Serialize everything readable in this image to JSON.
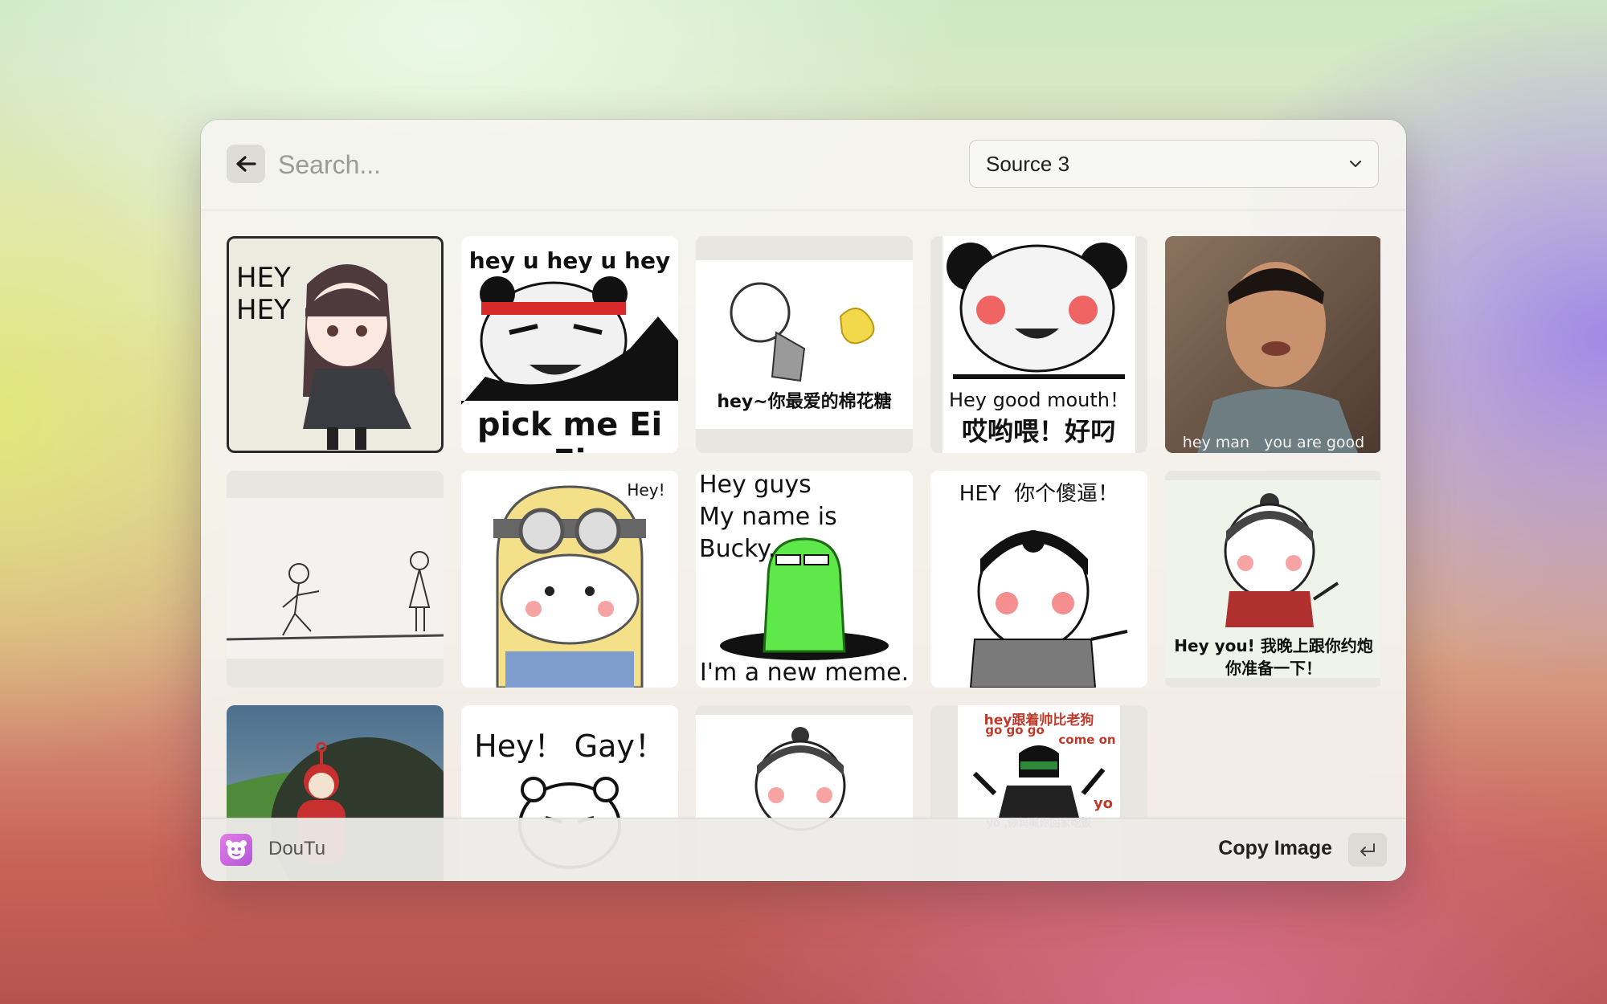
{
  "search": {
    "placeholder": "Search..."
  },
  "source_select": {
    "selected": "Source 3"
  },
  "grid": {
    "items": [
      {
        "caption": "HEY HEY"
      },
      {
        "caption_top": "hey u hey u hey",
        "caption_bottom": "pick me Ei Ei"
      },
      {
        "caption": "hey~你最爱的棉花糖"
      },
      {
        "caption": "Hey good mouth！",
        "caption_2": "哎哟喂！好叼"
      },
      {
        "caption": "hey man   you are good"
      },
      {
        "caption": ""
      },
      {
        "caption": "Hey!"
      },
      {
        "caption_lines": [
          "Hey guys",
          "My name is",
          "Bucky."
        ],
        "caption_bottom": "I'm a new meme."
      },
      {
        "caption": "HEY  你个傻逼！"
      },
      {
        "caption": "Hey you! 我晚上跟你约炮",
        "caption_2": "你准备一下！"
      },
      {
        "caption": ""
      },
      {
        "caption": "Hey！ Gay！"
      },
      {
        "caption": ""
      },
      {
        "caption_lines": [
          "hey跟着帅比老狗",
          "go go go",
          "come on",
          "yo",
          "yo ,你妈喊你回家吃饭"
        ]
      }
    ]
  },
  "footer": {
    "app_name": "DouTu",
    "action_label": "Copy Image"
  }
}
